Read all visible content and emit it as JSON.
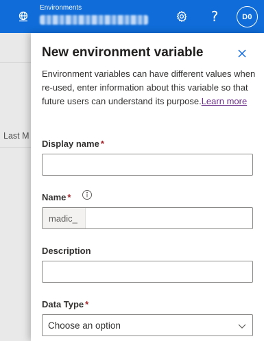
{
  "topbar": {
    "environment_label": "Environments",
    "icons": [
      "environment-globe-icon",
      "gear-icon",
      "help-icon"
    ],
    "help_glyph": "?",
    "avatar_initials": "D0"
  },
  "background": {
    "column_header": "Last M"
  },
  "panel": {
    "title": "New environment variable",
    "description": "Environment variables can have different values when re-used, enter information about this variable so that future users can understand its purpose.",
    "learn_more": "Learn more",
    "fields": {
      "display_name": {
        "label": "Display name",
        "required_mark": "*",
        "value": ""
      },
      "name": {
        "label": "Name",
        "required_mark": "*",
        "prefix": "madic_",
        "value": ""
      },
      "description": {
        "label": "Description",
        "value": ""
      },
      "data_type": {
        "label": "Data Type",
        "required_mark": "*",
        "selected": "Choose an option"
      }
    }
  },
  "colors": {
    "topbar_bg": "#0f6cd8",
    "required": "#a4262c",
    "link": "#6b2d8a",
    "close_icon": "#0f6cd8"
  }
}
